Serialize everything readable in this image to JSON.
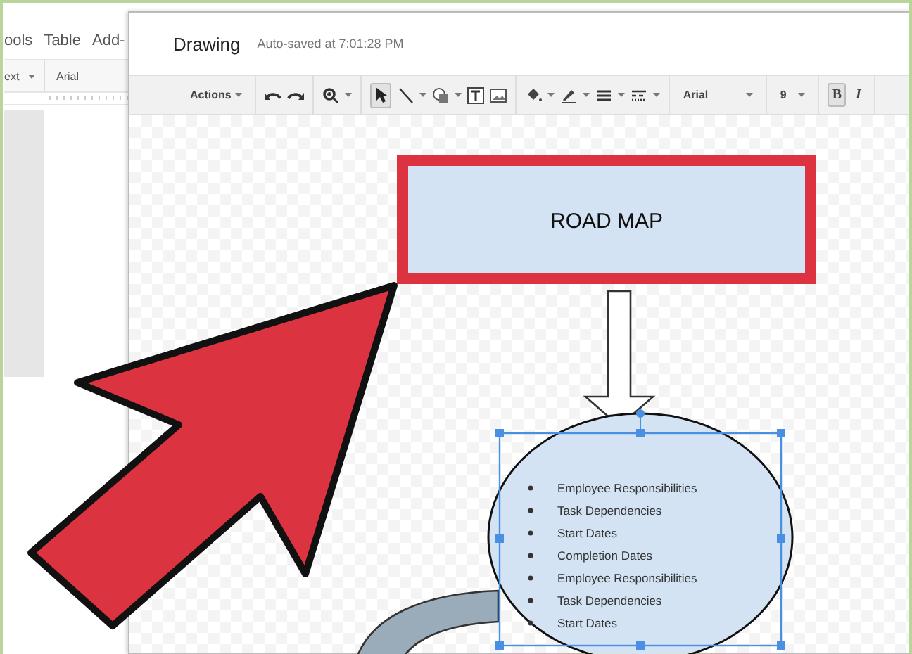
{
  "doc_menu": [
    "ools",
    "Table",
    "Add-"
  ],
  "doc_toolbar": {
    "style": "ext",
    "font": "Arial"
  },
  "dialog": {
    "title": "Drawing",
    "autosave": "Auto-saved at 7:01:28 PM"
  },
  "toolbar": {
    "actions": "Actions",
    "select_pressed": true,
    "font": "Arial",
    "size": "9",
    "bold": "B",
    "bold_pressed": true,
    "italic": "I"
  },
  "canvas": {
    "title_box": "ROAD MAP",
    "list": [
      "Employee Responsibilities",
      "Task Dependencies",
      "Start Dates",
      "Completion Dates",
      "Employee Responsibilities",
      "Task Dependencies",
      "Start Dates"
    ]
  }
}
